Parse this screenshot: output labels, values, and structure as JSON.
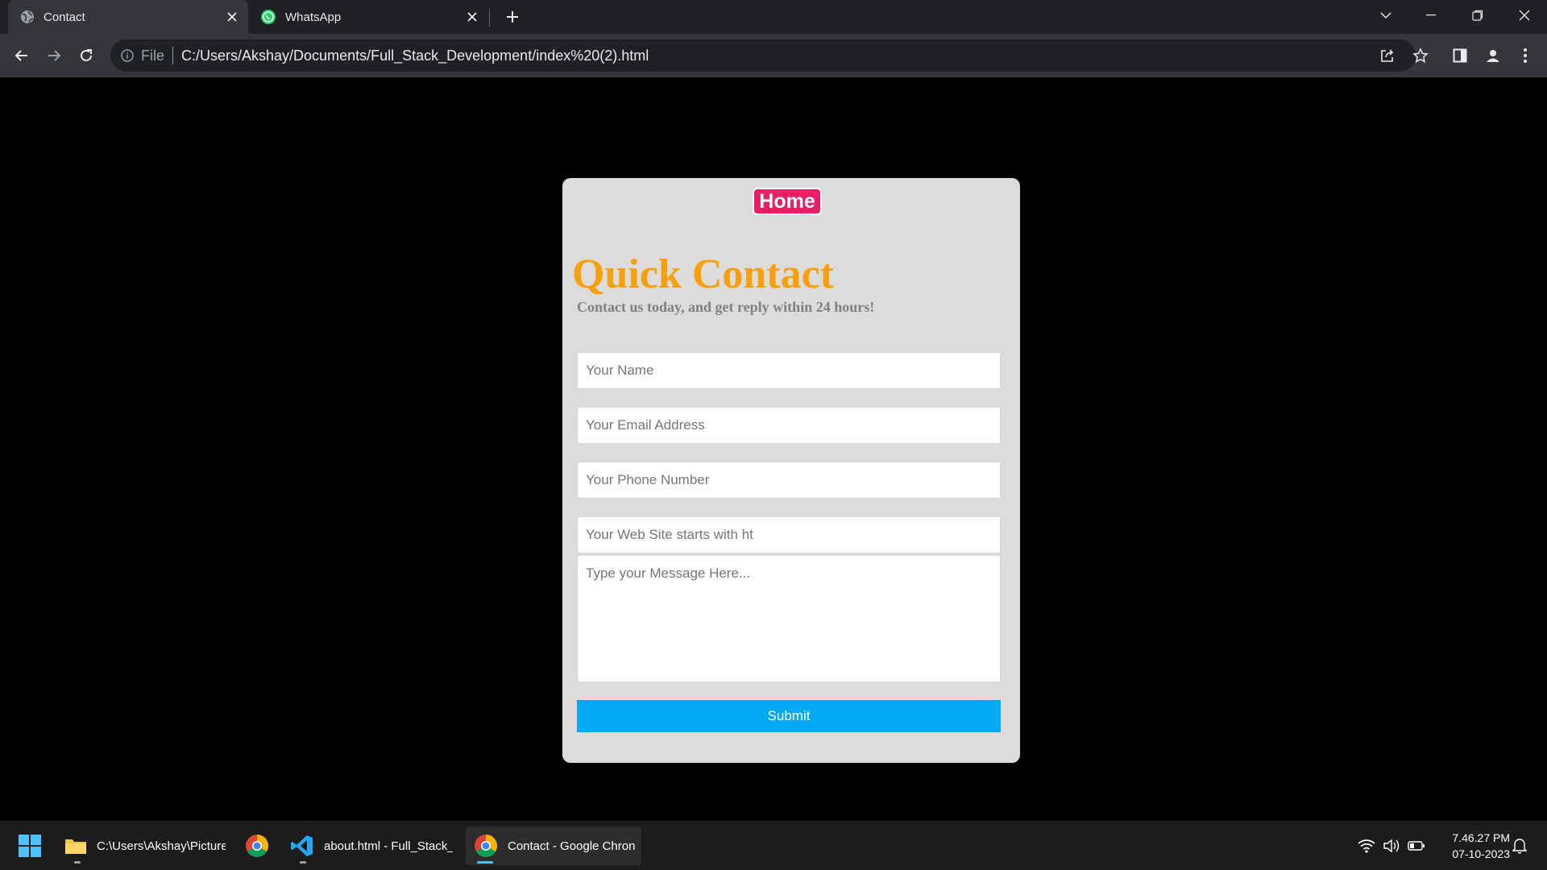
{
  "browser": {
    "tabs": [
      {
        "title": "Contact",
        "icon": "globe-icon",
        "active": true
      },
      {
        "title": "WhatsApp",
        "icon": "whatsapp-icon",
        "active": false
      }
    ],
    "address": {
      "scheme_label": "File",
      "url": "C:/Users/Akshay/Documents/Full_Stack_Development/index%20(2).html"
    }
  },
  "page": {
    "home_label": "Home",
    "title": "Quick Contact",
    "subtitle": "Contact us today, and get reply within 24 hours!",
    "fields": {
      "name_placeholder": "Your Name",
      "email_placeholder": "Your Email Address",
      "phone_placeholder": "Your Phone Number",
      "website_placeholder": "Your Web Site starts with ht",
      "message_placeholder": "Type your Message Here..."
    },
    "submit_label": "Submit",
    "colors": {
      "title": "#f5a00c",
      "home_button": "#e91e63",
      "submit_button": "#03a9f4",
      "card": "#dedcdb",
      "background": "#000000"
    }
  },
  "taskbar": {
    "items": [
      {
        "label": "C:\\Users\\Akshay\\Picture",
        "icon": "folder-icon"
      },
      {
        "label": "",
        "icon": "chrome-icon"
      },
      {
        "label": "about.html - Full_Stack_",
        "icon": "vscode-icon"
      },
      {
        "label": "Contact - Google Chron",
        "icon": "chrome-icon",
        "active": true
      }
    ],
    "time": "7.46.27 PM",
    "date": "07-10-2023"
  }
}
